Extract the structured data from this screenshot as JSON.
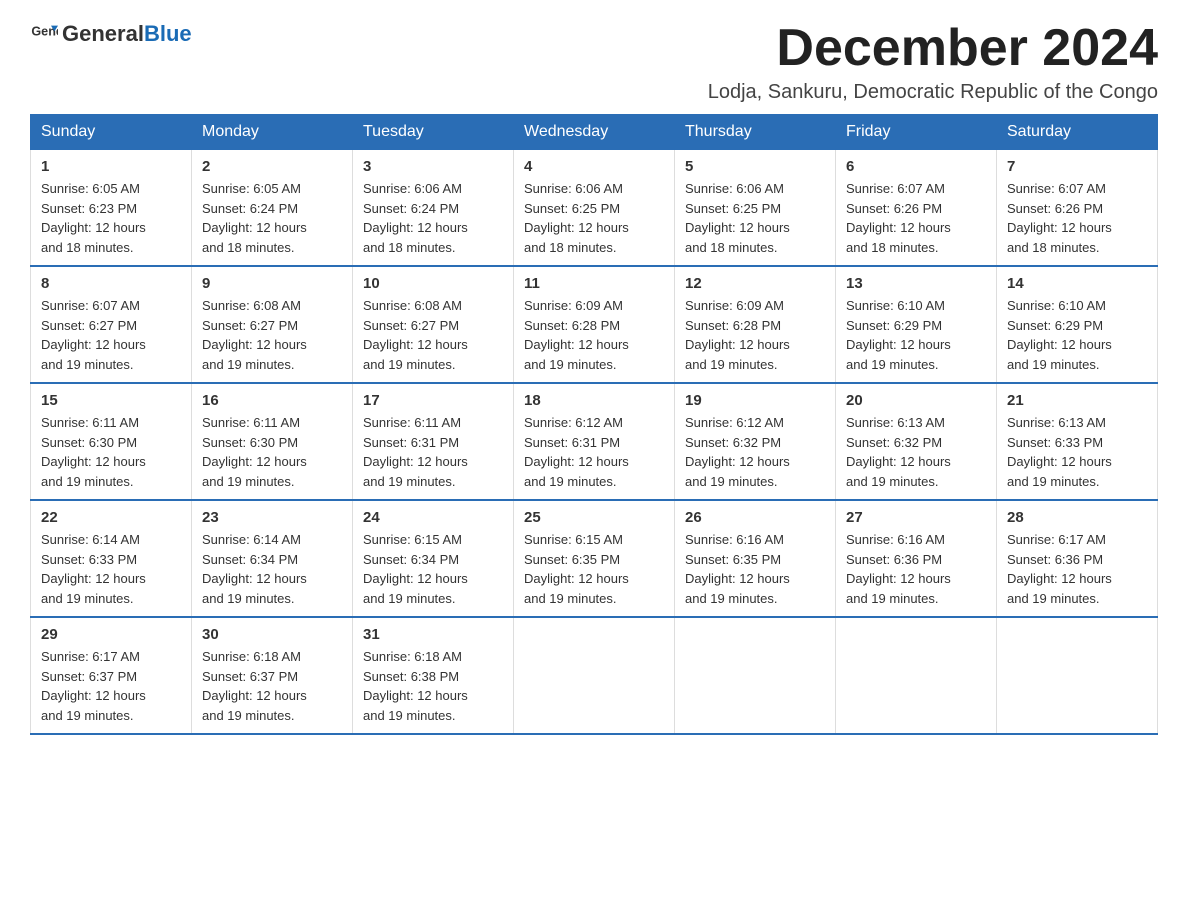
{
  "logo": {
    "text_general": "General",
    "text_blue": "Blue"
  },
  "header": {
    "month_year": "December 2024",
    "location": "Lodja, Sankuru, Democratic Republic of the Congo"
  },
  "days_of_week": [
    "Sunday",
    "Monday",
    "Tuesday",
    "Wednesday",
    "Thursday",
    "Friday",
    "Saturday"
  ],
  "weeks": [
    [
      {
        "day": "1",
        "sunrise": "6:05 AM",
        "sunset": "6:23 PM",
        "daylight": "12 hours and 18 minutes."
      },
      {
        "day": "2",
        "sunrise": "6:05 AM",
        "sunset": "6:24 PM",
        "daylight": "12 hours and 18 minutes."
      },
      {
        "day": "3",
        "sunrise": "6:06 AM",
        "sunset": "6:24 PM",
        "daylight": "12 hours and 18 minutes."
      },
      {
        "day": "4",
        "sunrise": "6:06 AM",
        "sunset": "6:25 PM",
        "daylight": "12 hours and 18 minutes."
      },
      {
        "day": "5",
        "sunrise": "6:06 AM",
        "sunset": "6:25 PM",
        "daylight": "12 hours and 18 minutes."
      },
      {
        "day": "6",
        "sunrise": "6:07 AM",
        "sunset": "6:26 PM",
        "daylight": "12 hours and 18 minutes."
      },
      {
        "day": "7",
        "sunrise": "6:07 AM",
        "sunset": "6:26 PM",
        "daylight": "12 hours and 18 minutes."
      }
    ],
    [
      {
        "day": "8",
        "sunrise": "6:07 AM",
        "sunset": "6:27 PM",
        "daylight": "12 hours and 19 minutes."
      },
      {
        "day": "9",
        "sunrise": "6:08 AM",
        "sunset": "6:27 PM",
        "daylight": "12 hours and 19 minutes."
      },
      {
        "day": "10",
        "sunrise": "6:08 AM",
        "sunset": "6:27 PM",
        "daylight": "12 hours and 19 minutes."
      },
      {
        "day": "11",
        "sunrise": "6:09 AM",
        "sunset": "6:28 PM",
        "daylight": "12 hours and 19 minutes."
      },
      {
        "day": "12",
        "sunrise": "6:09 AM",
        "sunset": "6:28 PM",
        "daylight": "12 hours and 19 minutes."
      },
      {
        "day": "13",
        "sunrise": "6:10 AM",
        "sunset": "6:29 PM",
        "daylight": "12 hours and 19 minutes."
      },
      {
        "day": "14",
        "sunrise": "6:10 AM",
        "sunset": "6:29 PM",
        "daylight": "12 hours and 19 minutes."
      }
    ],
    [
      {
        "day": "15",
        "sunrise": "6:11 AM",
        "sunset": "6:30 PM",
        "daylight": "12 hours and 19 minutes."
      },
      {
        "day": "16",
        "sunrise": "6:11 AM",
        "sunset": "6:30 PM",
        "daylight": "12 hours and 19 minutes."
      },
      {
        "day": "17",
        "sunrise": "6:11 AM",
        "sunset": "6:31 PM",
        "daylight": "12 hours and 19 minutes."
      },
      {
        "day": "18",
        "sunrise": "6:12 AM",
        "sunset": "6:31 PM",
        "daylight": "12 hours and 19 minutes."
      },
      {
        "day": "19",
        "sunrise": "6:12 AM",
        "sunset": "6:32 PM",
        "daylight": "12 hours and 19 minutes."
      },
      {
        "day": "20",
        "sunrise": "6:13 AM",
        "sunset": "6:32 PM",
        "daylight": "12 hours and 19 minutes."
      },
      {
        "day": "21",
        "sunrise": "6:13 AM",
        "sunset": "6:33 PM",
        "daylight": "12 hours and 19 minutes."
      }
    ],
    [
      {
        "day": "22",
        "sunrise": "6:14 AM",
        "sunset": "6:33 PM",
        "daylight": "12 hours and 19 minutes."
      },
      {
        "day": "23",
        "sunrise": "6:14 AM",
        "sunset": "6:34 PM",
        "daylight": "12 hours and 19 minutes."
      },
      {
        "day": "24",
        "sunrise": "6:15 AM",
        "sunset": "6:34 PM",
        "daylight": "12 hours and 19 minutes."
      },
      {
        "day": "25",
        "sunrise": "6:15 AM",
        "sunset": "6:35 PM",
        "daylight": "12 hours and 19 minutes."
      },
      {
        "day": "26",
        "sunrise": "6:16 AM",
        "sunset": "6:35 PM",
        "daylight": "12 hours and 19 minutes."
      },
      {
        "day": "27",
        "sunrise": "6:16 AM",
        "sunset": "6:36 PM",
        "daylight": "12 hours and 19 minutes."
      },
      {
        "day": "28",
        "sunrise": "6:17 AM",
        "sunset": "6:36 PM",
        "daylight": "12 hours and 19 minutes."
      }
    ],
    [
      {
        "day": "29",
        "sunrise": "6:17 AM",
        "sunset": "6:37 PM",
        "daylight": "12 hours and 19 minutes."
      },
      {
        "day": "30",
        "sunrise": "6:18 AM",
        "sunset": "6:37 PM",
        "daylight": "12 hours and 19 minutes."
      },
      {
        "day": "31",
        "sunrise": "6:18 AM",
        "sunset": "6:38 PM",
        "daylight": "12 hours and 19 minutes."
      },
      null,
      null,
      null,
      null
    ]
  ],
  "labels": {
    "sunrise": "Sunrise:",
    "sunset": "Sunset:",
    "daylight": "Daylight:"
  }
}
